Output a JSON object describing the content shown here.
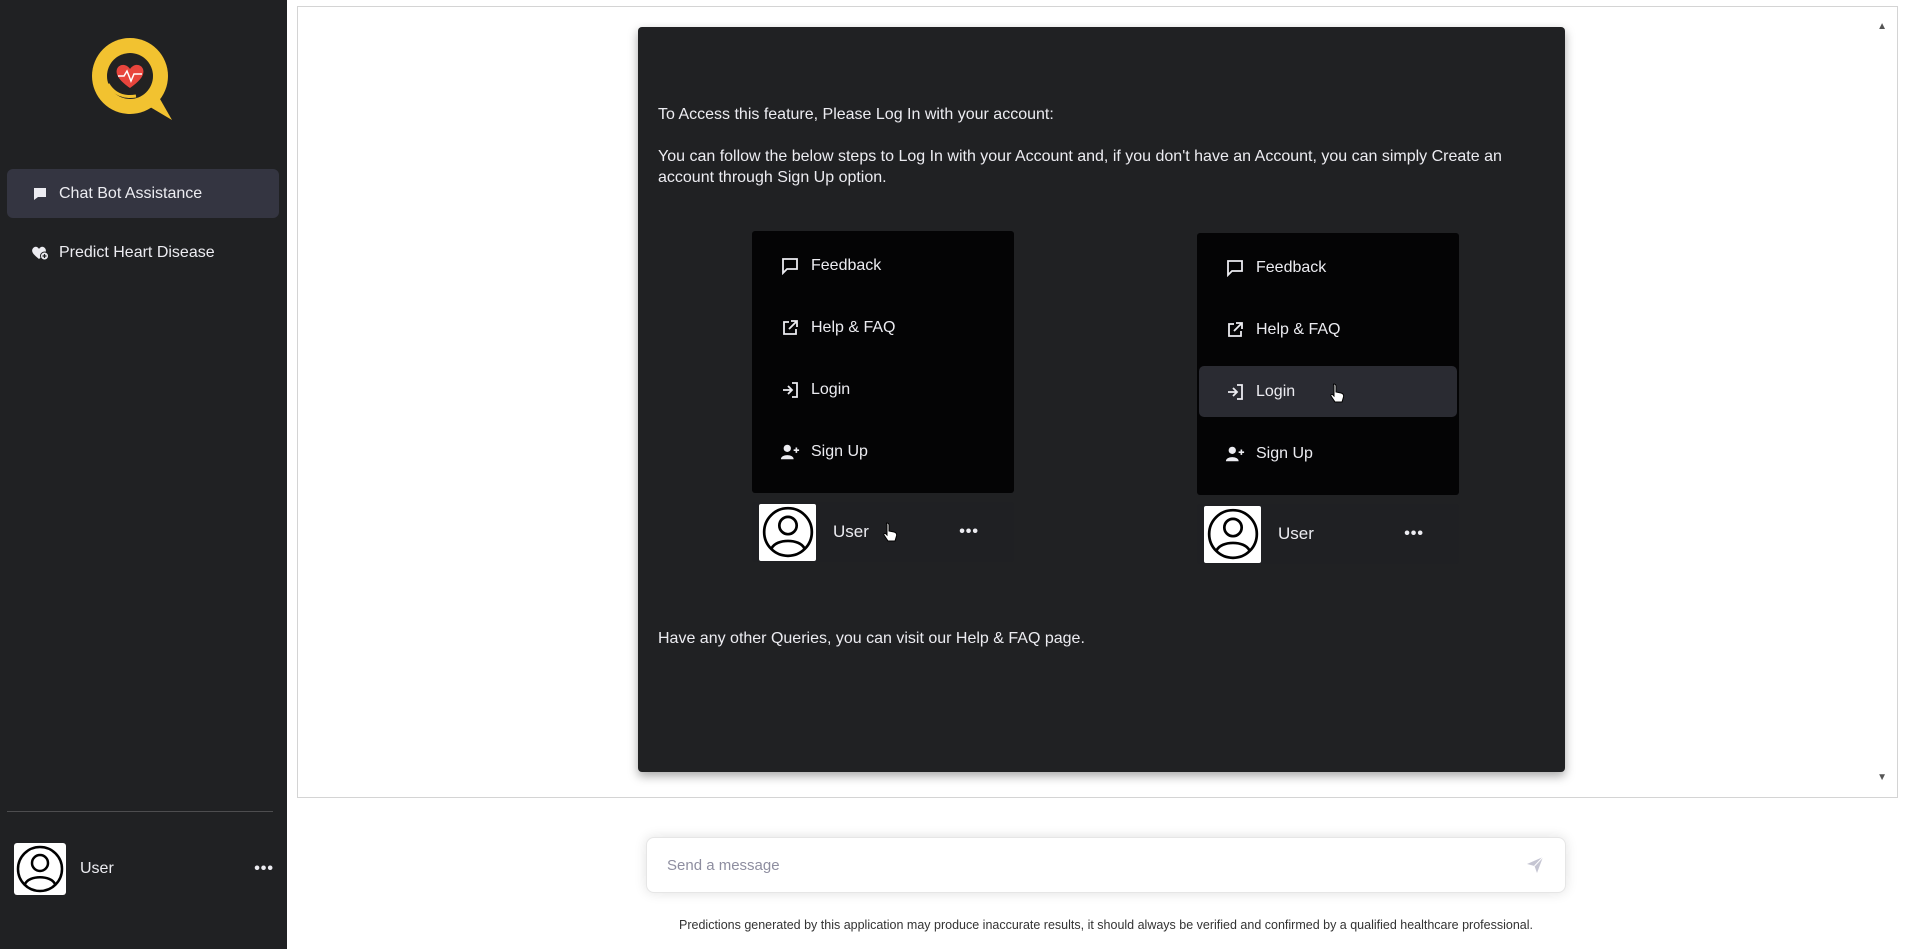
{
  "sidebar": {
    "nav": [
      {
        "label": "Chat Bot Assistance",
        "icon": "chat-icon",
        "active": true
      },
      {
        "label": "Predict Heart Disease",
        "icon": "heart-add-icon",
        "active": false
      }
    ],
    "user": {
      "name": "User",
      "more": "•••"
    }
  },
  "card": {
    "intro": "To Access this feature, Please Log In with your account:",
    "steps": "You can follow the below steps to Log In with your Account and, if you don't have an Account, you can simply Create an account through Sign Up option.",
    "footer": "Have any other Queries, you can visit our Help & FAQ page.",
    "menu": {
      "items": [
        "Feedback",
        "Help & FAQ",
        "Login",
        "Sign Up"
      ],
      "user_name": "User",
      "more": "•••"
    }
  },
  "composer": {
    "placeholder": "Send a message"
  },
  "disclaimer": "Predictions generated by this application may produce inaccurate results, it should always be verified and confirmed by a qualified healthcare professional.",
  "colors": {
    "sidebar_bg": "#202123",
    "logo_yellow": "#f4c430",
    "heart_red": "#e8453c"
  }
}
